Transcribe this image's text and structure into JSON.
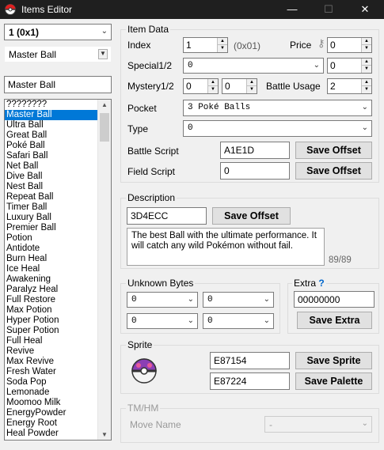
{
  "window": {
    "title": "Items Editor"
  },
  "left": {
    "item_select": "1   (0x1)",
    "name_combo": "Master Ball",
    "name_field": "Master Ball",
    "items": [
      "????????",
      "Master Ball",
      "Ultra Ball",
      "Great Ball",
      "Poké Ball",
      "Safari Ball",
      "Net Ball",
      "Dive Ball",
      "Nest Ball",
      "Repeat Ball",
      "Timer Ball",
      "Luxury Ball",
      "Premier Ball",
      "Potion",
      "Antidote",
      "Burn Heal",
      "Ice Heal",
      "Awakening",
      "Paralyz Heal",
      "Full Restore",
      "Max Potion",
      "Hyper Potion",
      "Super Potion",
      "Full Heal",
      "Revive",
      "Max Revive",
      "Fresh Water",
      "Soda Pop",
      "Lemonade",
      "Moomoo Milk",
      "EnergyPowder",
      "Energy Root",
      "Heal Powder"
    ],
    "selected_index": 1
  },
  "item_data": {
    "group_label": "Item Data",
    "index_label": "Index",
    "index_value": "1",
    "index_hex": "(0x01)",
    "price_label": "Price",
    "price_value": "0",
    "special_label": "Special1/2",
    "special_combo": "0",
    "special_value": "0",
    "mystery_label": "Mystery1/2",
    "mystery1": "0",
    "mystery2": "0",
    "battle_usage_label": "Battle Usage",
    "battle_usage_value": "2",
    "pocket_label": "Pocket",
    "pocket_value": "3 Poké Balls",
    "type_label": "Type",
    "type_value": "0",
    "battle_script_label": "Battle Script",
    "battle_script_value": "A1E1D",
    "field_script_label": "Field Script",
    "field_script_value": "0",
    "save_offset_label": "Save Offset"
  },
  "description": {
    "group_label": "Description",
    "offset": "3D4ECC",
    "save_label": "Save Offset",
    "text": "The best Ball with the ultimate performance. It will catch any wild Pokémon without fail.",
    "count": "89/89"
  },
  "unknown_bytes": {
    "group_label": "Unknown Bytes",
    "values": [
      "0",
      "0",
      "0",
      "0"
    ]
  },
  "extra": {
    "group_label": "Extra",
    "help": "?",
    "value": "00000000",
    "save_label": "Save Extra"
  },
  "sprite": {
    "group_label": "Sprite",
    "sprite_offset": "E87154",
    "palette_offset": "E87224",
    "save_sprite_label": "Save Sprite",
    "save_palette_label": "Save Palette"
  },
  "tmhm": {
    "group_label": "TM/HM",
    "move_name_label": "Move Name",
    "move_value": "-"
  },
  "colors": {
    "titlebar": "#1f1f1f",
    "selection": "#0078d7",
    "ball_purple": "#8b3fb5"
  }
}
